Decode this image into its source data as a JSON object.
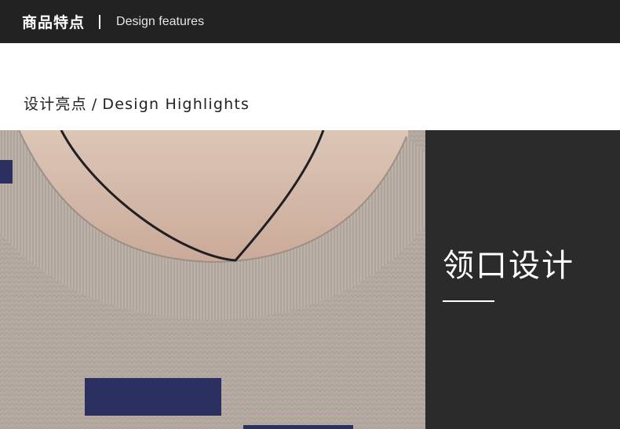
{
  "header": {
    "title_cn": "商品特点",
    "title_en": "Design features"
  },
  "section": {
    "title_cn": "设计亮点",
    "separator": "/",
    "title_en": "Design Highlights"
  },
  "feature_panel": {
    "title": "领口设计"
  },
  "colors": {
    "header_bg": "#222222",
    "panel_bg": "#2b2b2b",
    "sweater": "#b5aba2",
    "stripe": "#2c3061"
  }
}
